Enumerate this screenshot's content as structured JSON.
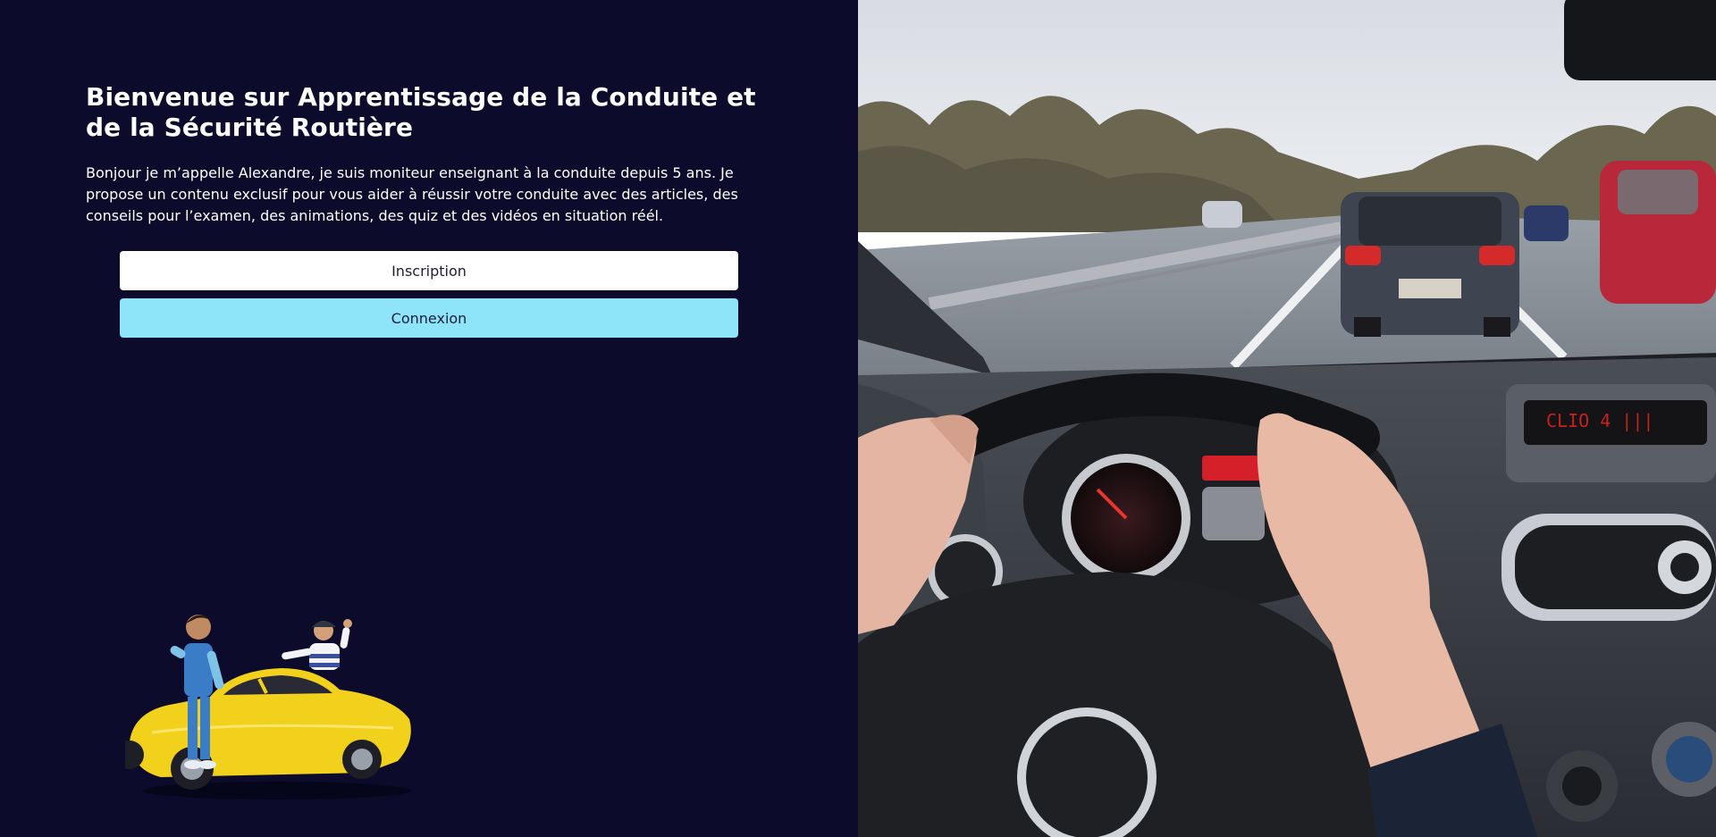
{
  "welcome": {
    "title": "Bienvenue sur Apprentissage de la Conduite et de la Sécurité Routière",
    "intro": "Bonjour je m’appelle Alexandre, je suis moniteur enseignant à la conduite depuis 5 ans. Je propose un contenu exclusif pour vous aider à réussir votre conduite avec des articles, des conseils pour l’examen, des animations, des quiz et des vidéos en situation réél."
  },
  "actions": {
    "inscription_label": "Inscription",
    "connexion_label": "Connexion"
  },
  "illustration": {
    "icon": "car-with-people-illustration"
  },
  "hero": {
    "icon": "driving-photo"
  },
  "colors": {
    "left_background": "#0c0b2c",
    "connexion_button": "#8ee4f8",
    "inscription_button": "#ffffff"
  }
}
